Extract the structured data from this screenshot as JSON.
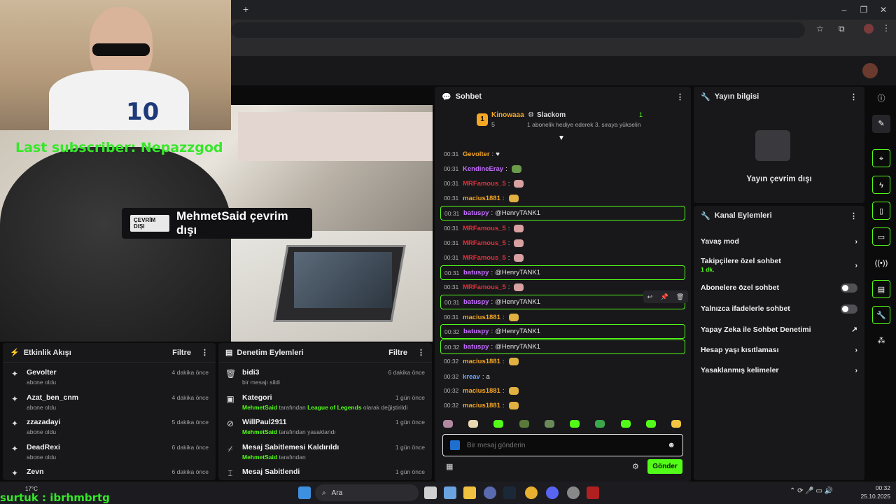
{
  "overlay": {
    "last_subscriber": "Last subscriber: Nepazzgod",
    "viewer_name": "surtuk : ibrhmbrtg"
  },
  "video": {
    "offline_badge": "ÇEVRİM DIŞI",
    "offline_text": "MehmetSaid çevrim dışı"
  },
  "activity": {
    "title": "Etkinlik Akışı",
    "filter": "Filtre",
    "items": [
      {
        "name": "Gevolter",
        "action": "abone oldu",
        "time": "4 dakika önce"
      },
      {
        "name": "Azat_ben_cnm",
        "action": "abone oldu",
        "time": "4 dakika önce"
      },
      {
        "name": "zzazadayi",
        "action": "abone oldu",
        "time": "5 dakika önce"
      },
      {
        "name": "DeadRexi",
        "action": "abone oldu",
        "time": "6 dakika önce"
      },
      {
        "name": "Zevn",
        "action": "",
        "time": "6 dakika önce"
      }
    ]
  },
  "moderation": {
    "title": "Denetim Eylemleri",
    "filter": "Filtre",
    "items": [
      {
        "name": "bidi3",
        "sub_pre": "",
        "sub_user": "",
        "sub_post": "bir mesajı sildi",
        "sub_extra": "",
        "sub_end": "",
        "time": "6 dakika önce"
      },
      {
        "name": "Kategori",
        "sub_pre": "",
        "sub_user": "MehmetSaid",
        "sub_post": " tarafından ",
        "sub_extra": "League of Legends",
        "sub_end": " olarak değiştirildi",
        "time": "1 gün önce"
      },
      {
        "name": "WillPaul2911",
        "sub_pre": "",
        "sub_user": "MehmetSaid",
        "sub_post": " tarafından yasaklandı",
        "sub_extra": "",
        "sub_end": "",
        "time": "1 gün önce"
      },
      {
        "name": "Mesaj Sabitlemesi Kaldırıldı",
        "sub_pre": "",
        "sub_user": "MehmetSaid",
        "sub_post": " tarafından",
        "sub_extra": "",
        "sub_end": "",
        "time": "1 gün önce"
      },
      {
        "name": "Mesaj Sabitlendi",
        "sub_pre": "",
        "sub_user": "",
        "sub_post": "",
        "sub_extra": "",
        "sub_end": "",
        "time": "1 gün önce"
      }
    ]
  },
  "chat": {
    "title": "Sohbet",
    "leader1": {
      "rank": "1",
      "name": "Kinowaaa",
      "count": "5"
    },
    "leader2": {
      "name": "Slackom",
      "count": "1",
      "note": "1 abonelik hediye ederek 3. sıraya yükselin"
    },
    "messages": [
      {
        "time": "00:31",
        "user": "Gevolter",
        "color": "#f5a623",
        "text": "♥",
        "hl": false
      },
      {
        "time": "00:31",
        "user": "KendineEray",
        "color": "#c46cff",
        "text": "",
        "hl": false
      },
      {
        "time": "00:31",
        "user": "MRFamous_5",
        "color": "#e0303a",
        "text": "",
        "hl": false
      },
      {
        "time": "00:31",
        "user": "macius1881",
        "color": "#f5a623",
        "text": "",
        "hl": false
      },
      {
        "time": "00:31",
        "user": "batuspy",
        "color": "#c46cff",
        "text": "@HenryTANK1",
        "hl": true
      },
      {
        "time": "00:31",
        "user": "MRFamous_5",
        "color": "#e0303a",
        "text": "",
        "hl": false
      },
      {
        "time": "00:31",
        "user": "MRFamous_5",
        "color": "#e0303a",
        "text": "",
        "hl": false
      },
      {
        "time": "00:31",
        "user": "MRFamous_5",
        "color": "#e0303a",
        "text": "",
        "hl": false
      },
      {
        "time": "00:31",
        "user": "batuspy",
        "color": "#c46cff",
        "text": "@HenryTANK1",
        "hl": true
      },
      {
        "time": "00:31",
        "user": "MRFamous_5",
        "color": "#e0303a",
        "text": "",
        "hl": false
      },
      {
        "time": "00:31",
        "user": "batuspy",
        "color": "#c46cff",
        "text": "@HenryTANK1",
        "hl": true
      },
      {
        "time": "00:31",
        "user": "macius1881",
        "color": "#f5a623",
        "text": "",
        "hl": false
      },
      {
        "time": "00:32",
        "user": "batuspy",
        "color": "#c46cff",
        "text": "@HenryTANK1",
        "hl": true
      },
      {
        "time": "00:32",
        "user": "batuspy",
        "color": "#c46cff",
        "text": "@HenryTANK1",
        "hl": true
      },
      {
        "time": "00:32",
        "user": "macius1881",
        "color": "#f5a623",
        "text": "",
        "hl": false
      },
      {
        "time": "00:32",
        "user": "kreav",
        "color": "#6fa8ff",
        "text": "a",
        "hl": false
      },
      {
        "time": "00:32",
        "user": "macius1881",
        "color": "#f5a623",
        "text": "",
        "hl": false
      },
      {
        "time": "00:32",
        "user": "macius1881",
        "color": "#f5a623",
        "text": "",
        "hl": false
      }
    ],
    "input_placeholder": "Bir mesaj gönderin",
    "send": "Gönder"
  },
  "stream_info": {
    "title": "Yayın bilgisi",
    "offline": "Yayın çevrim dışı"
  },
  "channel_actions": {
    "title": "Kanal Eylemleri",
    "slow_mode": "Yavaş mod",
    "followers_only": "Takipçilere özel sohbet",
    "followers_only_value": "1 dk.",
    "subs_only": "Abonelere özel sohbet",
    "emotes_only": "Yalnızca ifadelerle sohbet",
    "ai_moderation": "Yapay Zeka ile Sohbet Denetimi",
    "account_age": "Hesap yaşı kısıtlaması",
    "banned_words": "Yasaklanmış kelimeler"
  },
  "taskbar": {
    "search": "Ara",
    "weather_temp": "17°C",
    "time": "00:32",
    "date": "25.10.2025"
  },
  "colors": {
    "accent": "#53fc18",
    "panel": "#18181b",
    "bg": "#0b0b0c"
  }
}
